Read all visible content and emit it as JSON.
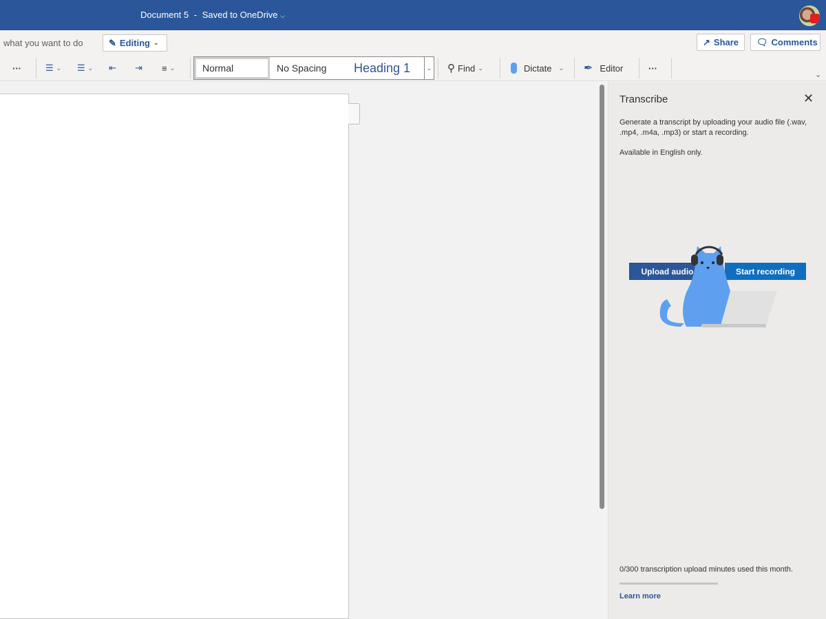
{
  "titlebar": {
    "document_name": "Document 5",
    "separator": "-",
    "save_status": "Saved to OneDrive"
  },
  "row2": {
    "tell_me": "what you want to do",
    "editing_label": "Editing",
    "share_label": "Share",
    "comments_label": "Comments"
  },
  "toolbar": {
    "more_label": "···",
    "styles": [
      "Normal",
      "No Spacing",
      "Heading 1"
    ],
    "find_label": "Find",
    "dictate_label": "Dictate",
    "editor_label": "Editor",
    "overflow_label": "···"
  },
  "pane": {
    "title": "Transcribe",
    "description": "Generate a transcript by uploading your audio file (.wav, .mp4, .m4a, .mp3) or start a recording.",
    "availability": "Available in English only.",
    "upload_label": "Upload audio",
    "record_label": "Start recording",
    "usage_text": "0/300 transcription upload minutes used this month.",
    "usage_used": 0,
    "usage_total": 300,
    "learn_more": "Learn more"
  },
  "colors": {
    "brand": "#2b579a",
    "record_button": "#106ebe",
    "cat": "#5ea0ef"
  }
}
